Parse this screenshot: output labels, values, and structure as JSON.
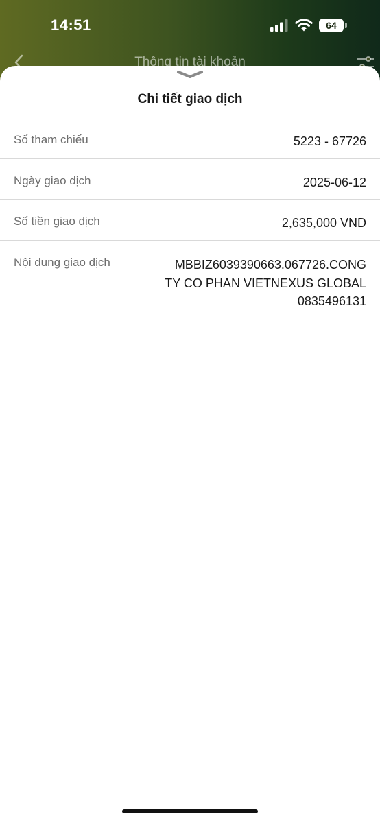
{
  "status_bar": {
    "time": "14:51",
    "battery_level": "64"
  },
  "nav": {
    "title": "Thông tin tài khoản"
  },
  "sheet": {
    "title": "Chi tiết giao dịch",
    "rows": [
      {
        "label": "Số tham chiếu",
        "value": "5223 - 67726"
      },
      {
        "label": "Ngày giao dịch",
        "value": "2025-06-12"
      },
      {
        "label": "Số tiền giao dịch",
        "value": "2,635,000 VND"
      },
      {
        "label": "Nội dung giao dịch",
        "value_lines": [
          "MBBIZ6039390663.067726.CONG",
          "TY CO PHAN VIETNEXUS GLOBAL",
          "0835496131"
        ]
      }
    ]
  },
  "colors": {
    "backdrop_start": "#5f6a22",
    "backdrop_end": "#10291a",
    "label_text": "#6e6e6e",
    "value_text": "#1a1a1a",
    "divider": "#d9d9d9"
  }
}
